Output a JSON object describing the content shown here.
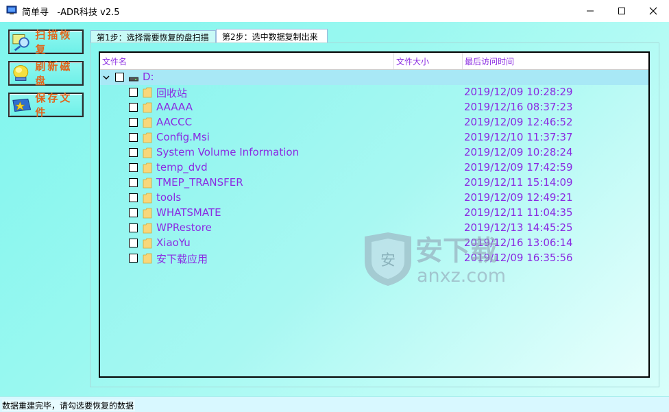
{
  "window": {
    "title": "简单寻   -ADR科技 v2.5"
  },
  "sidebar": {
    "buttons": [
      {
        "label": "扫描恢复",
        "icon": "magnifier-icon"
      },
      {
        "label": "刷新磁盘",
        "icon": "refresh-disk-icon"
      },
      {
        "label": "保存文件",
        "icon": "save-file-icon"
      }
    ]
  },
  "tabs": [
    {
      "label": "第1步：选择需要恢复的盘扫描",
      "active": false
    },
    {
      "label": "第2步：选中数据复制出来",
      "active": true
    }
  ],
  "table": {
    "columns": [
      "文件名",
      "文件大小",
      "最后访问时间"
    ],
    "root": {
      "name": "D:"
    },
    "rows": [
      {
        "name": "回收站",
        "time": "2019/12/09 10:28:29"
      },
      {
        "name": "AAAAA",
        "time": "2019/12/16 08:37:23"
      },
      {
        "name": "AACCC",
        "time": "2019/12/09 12:46:52"
      },
      {
        "name": "Config.Msi",
        "time": "2019/12/10 11:37:37"
      },
      {
        "name": "System Volume Information",
        "time": "2019/12/09 10:28:24"
      },
      {
        "name": "temp_dvd",
        "time": "2019/12/09 17:42:59"
      },
      {
        "name": "TMEP_TRANSFER",
        "time": "2019/12/11 15:14:09"
      },
      {
        "name": "tools",
        "time": "2019/12/09 12:49:21"
      },
      {
        "name": "WHATSMATE",
        "time": "2019/12/11 11:04:35"
      },
      {
        "name": "WPRestore",
        "time": "2019/12/13 14:45:25"
      },
      {
        "name": "XiaoYu",
        "time": "2019/12/16 13:06:14"
      },
      {
        "name": "安下载应用",
        "time": "2019/12/09 16:35:56"
      }
    ]
  },
  "watermark": {
    "brand": "安下载",
    "url": "anxz.com"
  },
  "status": {
    "text": "数据重建完毕，请勾选要恢复的数据"
  },
  "colors": {
    "accent_text": "#8a2be2",
    "button_label": "#e0661c",
    "background": "#7ef5ee"
  }
}
